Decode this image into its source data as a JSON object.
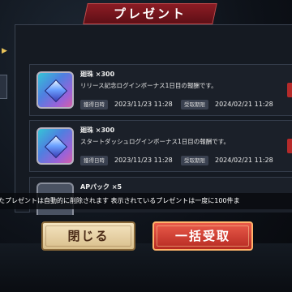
{
  "header": {
    "title": "プレゼント"
  },
  "presents": [
    {
      "name": "廻珠 ×300",
      "description": "リリース記念ログインボーナス1日目の報酬です。",
      "acquired_label": "獲得日時",
      "acquired_date": "2023/11/23 11:28",
      "expiry_label": "受取期限",
      "expiry_date": "2024/02/21 11:28"
    },
    {
      "name": "廻珠 ×300",
      "description": "スタートダッシュログインボーナス1日目の報酬です。",
      "acquired_label": "獲得日時",
      "acquired_date": "2023/11/23 11:28",
      "expiry_label": "受取期限",
      "expiry_date": "2024/02/21 11:28"
    },
    {
      "name": "APパック ×5"
    }
  ],
  "notice": "たプレゼントは自動的に削除されます 表示されているプレゼントは一度に100件ま",
  "buttons": {
    "close": "閉じる",
    "claim_all": "一括受取"
  },
  "colors": {
    "accent_red": "#b62a22",
    "banner_red": "#8c1c24",
    "close_button": "#e8d4a8"
  }
}
